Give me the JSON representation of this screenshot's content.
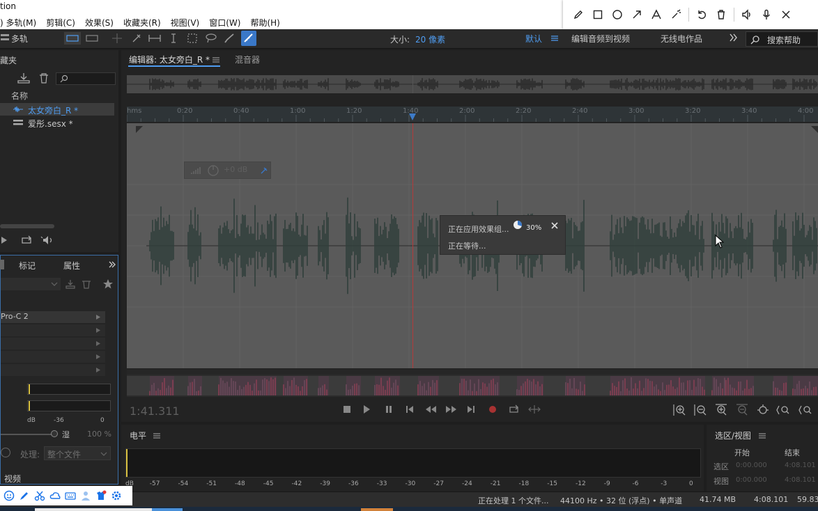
{
  "menubar": {
    "app_title_fragment": "tion",
    "items": [
      ") 多轨(M)",
      "剪辑(C)",
      "效果(S)",
      "收藏夹(R)",
      "视图(V)",
      "窗口(W)",
      "帮助(H)"
    ]
  },
  "annotation_tools": {
    "icons": [
      "pencil-icon",
      "rectangle-icon",
      "circle-icon",
      "arrow-icon",
      "text-icon",
      "magic-wand-icon",
      "undo-icon",
      "trash-icon",
      "speaker-icon",
      "microphone-icon",
      "close-icon"
    ]
  },
  "toolbar": {
    "multitrack_label": "多轨",
    "size_label": "大小:",
    "size_value": "20 像素",
    "workspace_default": "默认",
    "workspace_video": "编辑音频到视频",
    "workspace_radio": "无线电作品",
    "search_placeholder": "搜索帮助"
  },
  "files_panel": {
    "header_fragment": "藏夹",
    "column_name": "名称",
    "items": [
      {
        "name": "太女旁白_R *",
        "selected": true
      },
      {
        "name": "爱彤.sesx *",
        "selected": false
      }
    ]
  },
  "effects_panel": {
    "tabs": [
      "标记",
      "属性"
    ],
    "rack_item": "Pro-C 2",
    "meter_db_label": "dB",
    "meter_tick_1": "-36",
    "meter_tick_2": "0",
    "mix_label": "湿",
    "mix_value": "100 %",
    "process_label": "处理:",
    "process_value": "整个文件",
    "video_label": "视频"
  },
  "editor": {
    "tab_editor": "编辑器: 太女旁白_R *",
    "tab_mixer": "混音器",
    "ruler_labels": [
      "hms",
      "0:20",
      "0:40",
      "1:00",
      "1:20",
      "1:40",
      "2:00",
      "2:20",
      "2:40",
      "3:00",
      "3:20",
      "3:40",
      "4:00"
    ],
    "hud_gain": "+0 dB",
    "current_time": "1:41.311"
  },
  "progress_dialog": {
    "line1": "正在应用效果组...",
    "percent": "30%",
    "percent_value": 0.3,
    "line2": "正在等待..."
  },
  "level_panel": {
    "title": "电平",
    "ticks": [
      "dB",
      "-57",
      "-54",
      "-51",
      "-48",
      "-45",
      "-42",
      "-39",
      "-36",
      "-33",
      "-30",
      "-27",
      "-24",
      "-21",
      "-18",
      "-15",
      "-12",
      "-9",
      "-6",
      "-3",
      "0"
    ]
  },
  "selection_panel": {
    "title": "选区/视图",
    "col_start": "开始",
    "col_end": "结束",
    "row_selection": "选区",
    "row_view": "视图",
    "sel_start": "0:00.000",
    "sel_end": "4:08.101",
    "view_start": "0:00.000",
    "view_end": "4:08.101"
  },
  "statusbar": {
    "processing": "正在处理 1 个文件...",
    "format": "44100 Hz • 32 位 (浮点) • 单声道",
    "size": "41.74 MB",
    "duration": "4:08.101",
    "free": "59.83"
  },
  "colors": {
    "accent_blue": "#4f9cf0",
    "playhead": "#c0392b",
    "waveform": "#2f3f3b"
  }
}
